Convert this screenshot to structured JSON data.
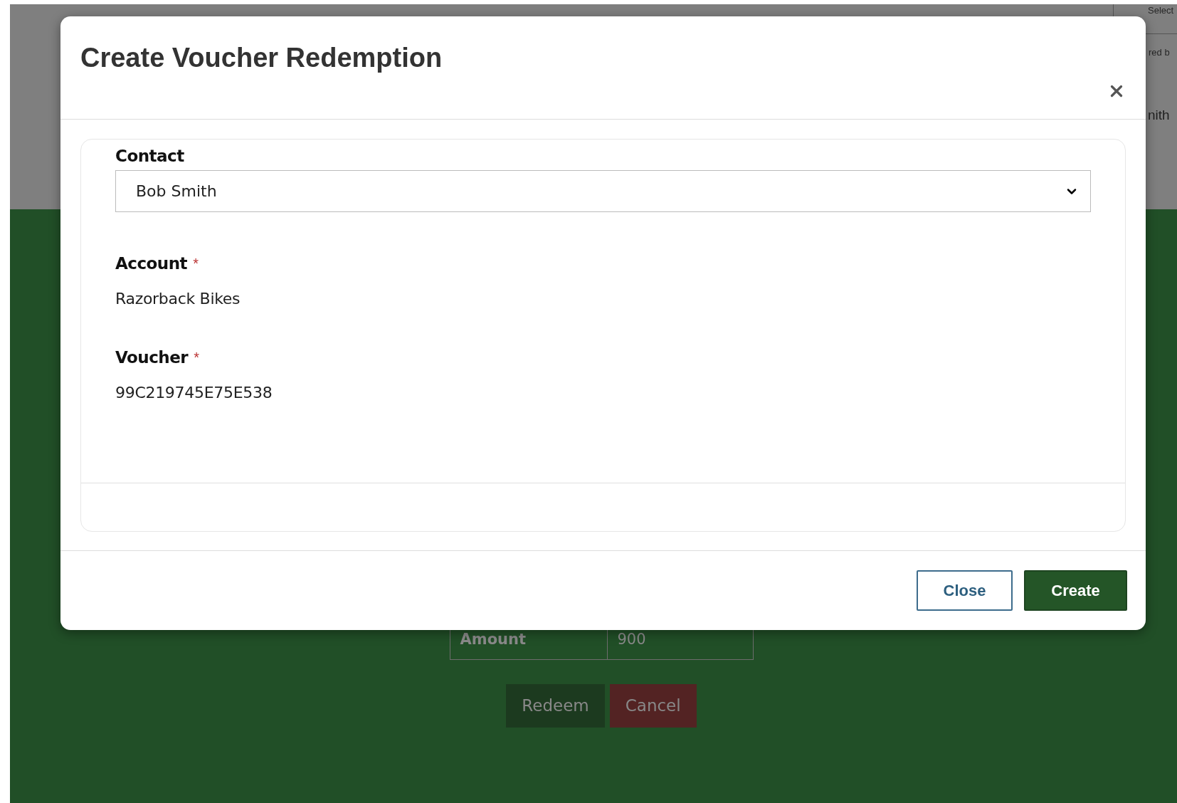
{
  "background": {
    "select_field": {
      "placeholder": "Select"
    },
    "caption": "red b",
    "name": "nith",
    "table": {
      "rows": [
        {
          "label": "Amount",
          "value": "900"
        }
      ]
    },
    "buttons": [
      {
        "label": "Redeem",
        "kind": "primary"
      },
      {
        "label": "Cancel",
        "kind": "danger"
      }
    ]
  },
  "dialog": {
    "title": "Create Voucher Redemption",
    "fields": [
      {
        "label": "Contact",
        "kind": "select",
        "value": "Bob Smith"
      },
      {
        "label": "Account",
        "required_mark": "*",
        "kind": "text",
        "value": "Razorback Bikes"
      },
      {
        "label": "Voucher",
        "required_mark": "*",
        "kind": "text",
        "value": "99C219745E75E538"
      }
    ],
    "buttons": [
      {
        "label": "Close",
        "kind": "secondary"
      },
      {
        "label": "Create",
        "kind": "primary"
      }
    ]
  }
}
